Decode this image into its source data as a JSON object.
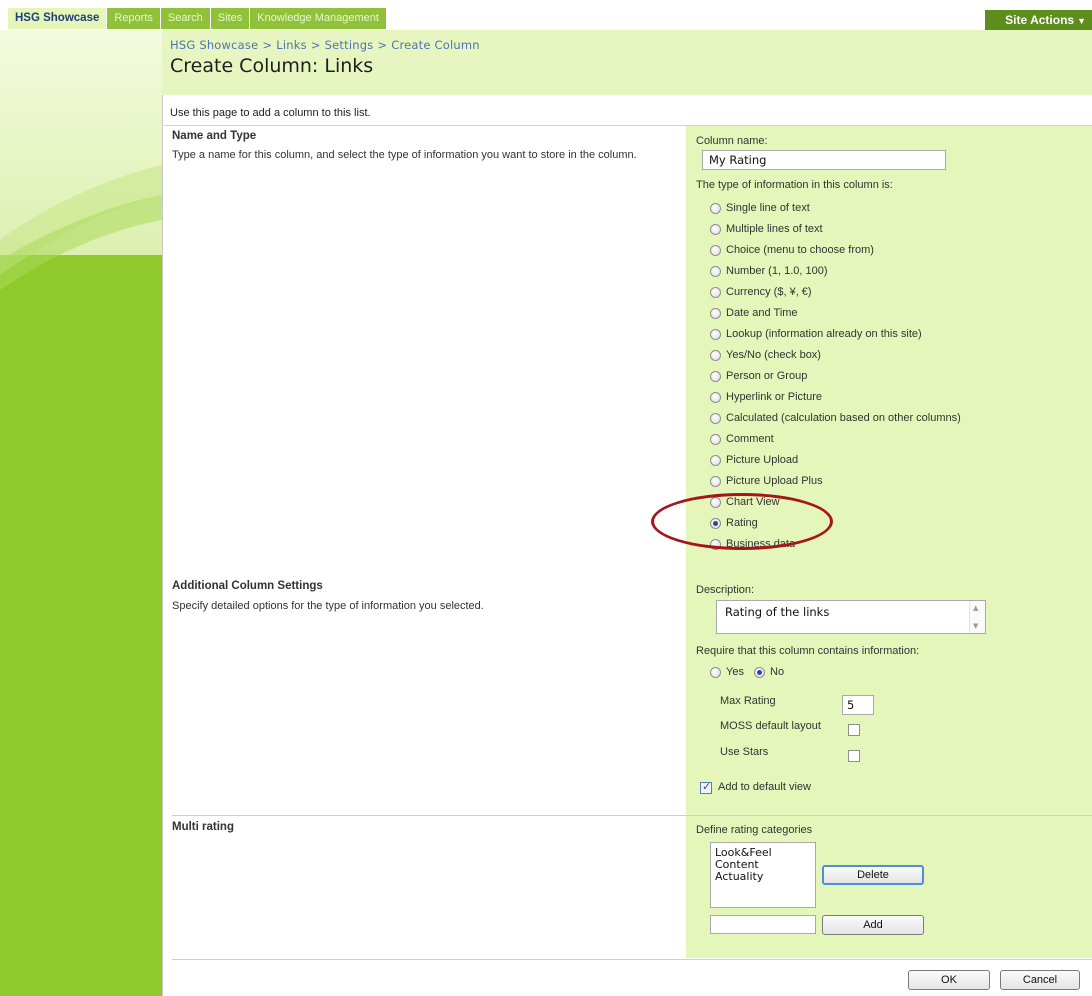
{
  "topnav": {
    "tabs": [
      {
        "label": "HSG Showcase",
        "active": true
      },
      {
        "label": "Reports",
        "active": false
      },
      {
        "label": "Search",
        "active": false
      },
      {
        "label": "Sites",
        "active": false
      },
      {
        "label": "Knowledge Management",
        "active": false
      }
    ],
    "site_actions": "Site Actions"
  },
  "breadcrumb": {
    "items": [
      "HSG Showcase",
      "Links",
      "Settings"
    ],
    "separator": ">",
    "current": "Create Column"
  },
  "page_title": "Create Column: Links",
  "intro": "Use this page to add a column to this list.",
  "name_and_type": {
    "title": "Name and Type",
    "description": "Type a name for this column, and select the type of information you want to store in the column.",
    "column_name_label": "Column name:",
    "column_name_value": "My Rating",
    "type_label": "The type of information in this column is:",
    "types": [
      {
        "label": "Single line of text",
        "checked": false
      },
      {
        "label": "Multiple lines of text",
        "checked": false
      },
      {
        "label": "Choice (menu to choose from)",
        "checked": false
      },
      {
        "label": "Number (1, 1.0, 100)",
        "checked": false
      },
      {
        "label": "Currency ($, ¥, €)",
        "checked": false
      },
      {
        "label": "Date and Time",
        "checked": false
      },
      {
        "label": "Lookup (information already on this site)",
        "checked": false
      },
      {
        "label": "Yes/No (check box)",
        "checked": false
      },
      {
        "label": "Person or Group",
        "checked": false
      },
      {
        "label": "Hyperlink or Picture",
        "checked": false
      },
      {
        "label": "Calculated (calculation based on other columns)",
        "checked": false
      },
      {
        "label": "Comment",
        "checked": false
      },
      {
        "label": "Picture Upload",
        "checked": false
      },
      {
        "label": "Picture Upload Plus",
        "checked": false
      },
      {
        "label": "Chart View",
        "checked": false
      },
      {
        "label": "Rating",
        "checked": true
      },
      {
        "label": "Business data",
        "checked": false
      }
    ]
  },
  "additional_settings": {
    "title": "Additional Column Settings",
    "description": "Specify detailed options for the type of information you selected.",
    "description_label": "Description:",
    "description_value": "Rating of the links",
    "require_label": "Require that this column contains information:",
    "require_yes": "Yes",
    "require_no": "No",
    "require_value": "No",
    "max_rating_label": "Max Rating",
    "max_rating_value": "5",
    "moss_layout_label": "MOSS default layout",
    "moss_layout_checked": false,
    "use_stars_label": "Use Stars",
    "use_stars_checked": false,
    "add_default_view_label": "Add to default view",
    "add_default_view_checked": true
  },
  "multi_rating": {
    "title": "Multi rating",
    "categories_label": "Define rating categories",
    "categories": [
      "Look&Feel",
      "Content",
      "Actuality"
    ],
    "delete_label": "Delete",
    "new_category_value": "",
    "add_label": "Add"
  },
  "footer": {
    "ok_label": "OK",
    "cancel_label": "Cancel"
  },
  "colors": {
    "nav_green": "#8fc92c",
    "panel_green": "#e4f6ba",
    "annotation_red": "#a5161a"
  }
}
